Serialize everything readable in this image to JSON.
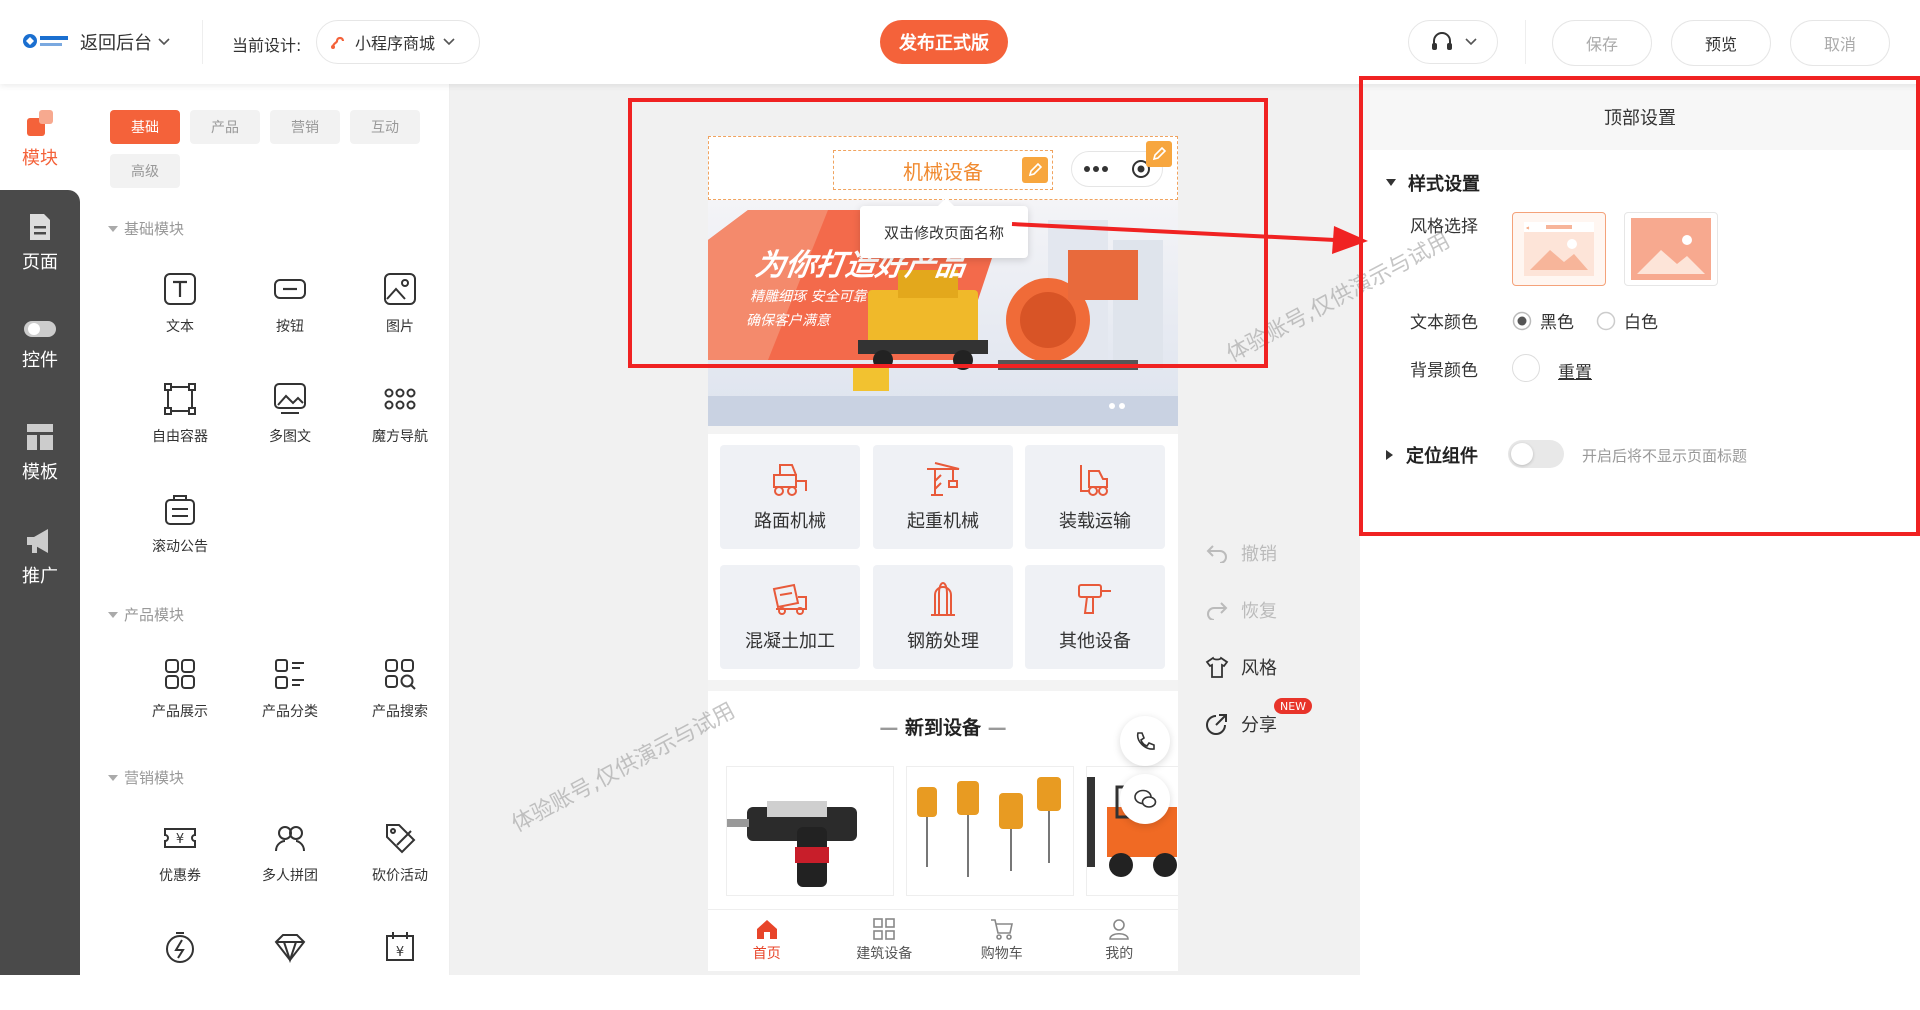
{
  "topbar": {
    "back_label": "返回后台",
    "current_design_label": "当前设计:",
    "design_name": "小程序商城",
    "publish_label": "发布正式版",
    "save_label": "保存",
    "preview_label": "预览",
    "cancel_label": "取消"
  },
  "sidebar": {
    "items": [
      {
        "label": "模块",
        "icon": "module-icon",
        "active": true
      },
      {
        "label": "页面",
        "icon": "page-icon"
      },
      {
        "label": "控件",
        "icon": "toggle-icon"
      },
      {
        "label": "模板",
        "icon": "template-icon"
      },
      {
        "label": "推广",
        "icon": "megaphone-icon"
      }
    ]
  },
  "module_panel": {
    "tabs": [
      "基础",
      "产品",
      "营销",
      "互动",
      "高级"
    ],
    "active_tab": "基础",
    "sections": [
      {
        "title": "基础模块",
        "items": [
          {
            "label": "文本",
            "icon": "text-icon"
          },
          {
            "label": "按钮",
            "icon": "button-icon"
          },
          {
            "label": "图片",
            "icon": "image-icon"
          },
          {
            "label": "自由容器",
            "icon": "container-icon"
          },
          {
            "label": "多图文",
            "icon": "multi-image-icon"
          },
          {
            "label": "魔方导航",
            "icon": "grid-nav-icon"
          },
          {
            "label": "滚动公告",
            "icon": "notice-icon"
          }
        ]
      },
      {
        "title": "产品模块",
        "items": [
          {
            "label": "产品展示",
            "icon": "product-grid-icon"
          },
          {
            "label": "产品分类",
            "icon": "category-icon"
          },
          {
            "label": "产品搜索",
            "icon": "product-search-icon"
          }
        ]
      },
      {
        "title": "营销模块",
        "items": [
          {
            "label": "优惠券",
            "icon": "coupon-icon"
          },
          {
            "label": "多人拼团",
            "icon": "group-buy-icon"
          },
          {
            "label": "砍价活动",
            "icon": "bargain-icon"
          },
          {
            "label": "",
            "icon": "flash-sale-icon"
          },
          {
            "label": "",
            "icon": "diamond-icon"
          },
          {
            "label": "",
            "icon": "price-calendar-icon"
          }
        ]
      }
    ]
  },
  "phone": {
    "page_title": "机械设备",
    "tooltip": "双击修改页面名称",
    "banner": {
      "headline": "为你打造好产品",
      "sub1": "精雕细琢 安全可靠",
      "sub2": "确保客户满意"
    },
    "categories": [
      {
        "label": "路面机械",
        "icon": "road-machine-icon"
      },
      {
        "label": "起重机械",
        "icon": "crane-icon"
      },
      {
        "label": "装载运输",
        "icon": "forklift-icon"
      },
      {
        "label": "混凝土加工",
        "icon": "mixer-icon"
      },
      {
        "label": "钢筋处理",
        "icon": "rebar-icon"
      },
      {
        "label": "其他设备",
        "icon": "drill-icon"
      }
    ],
    "new_section_title": "新到设备",
    "tabbar": [
      {
        "label": "首页",
        "icon": "home-icon",
        "active": true
      },
      {
        "label": "建筑设备",
        "icon": "apps-icon"
      },
      {
        "label": "购物车",
        "icon": "cart-icon"
      },
      {
        "label": "我的",
        "icon": "user-icon"
      }
    ]
  },
  "tools": {
    "undo": "撤销",
    "redo": "恢复",
    "style": "风格",
    "share": "分享",
    "new_badge": "NEW"
  },
  "settings": {
    "title": "顶部设置",
    "style_section": "样式设置",
    "style_choice_label": "风格选择",
    "text_color_label": "文本颜色",
    "text_color_options": [
      "黑色",
      "白色"
    ],
    "text_color_selected": "黑色",
    "bg_color_label": "背景颜色",
    "reset_label": "重置",
    "position_section": "定位组件",
    "position_hint": "开启后将不显示页面标题",
    "position_enabled": false
  },
  "watermark": "体验账号,仅供演示与试用",
  "colors": {
    "accent": "#f4623a",
    "highlight": "#f02222",
    "title_orange": "#f08a30"
  }
}
